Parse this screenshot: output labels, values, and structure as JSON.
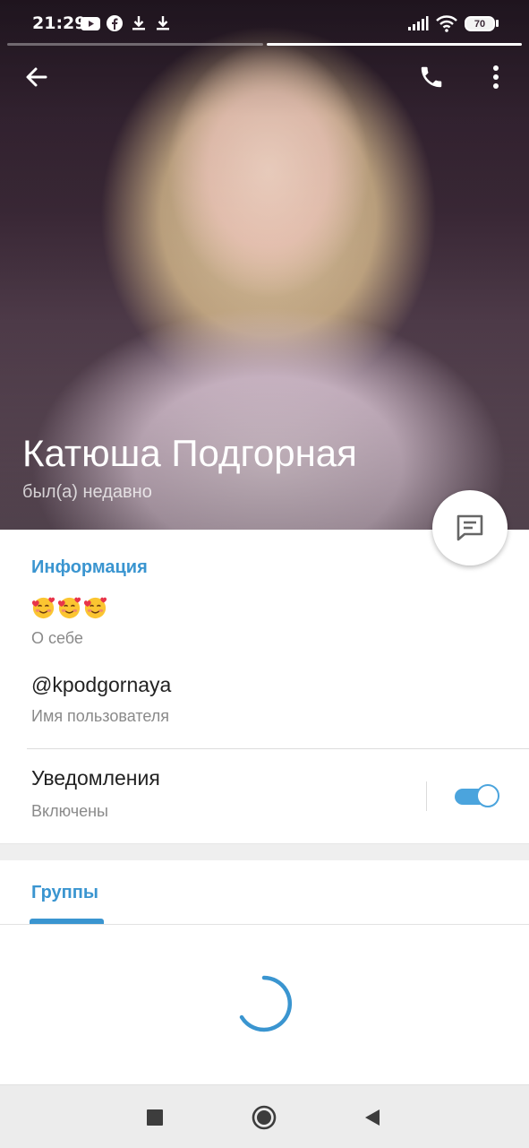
{
  "status_bar": {
    "time": "21:29",
    "battery": "70",
    "left_icons": [
      "youtube-icon",
      "facebook-icon",
      "download-icon",
      "download-icon"
    ],
    "right_icons": [
      "signal-icon",
      "wifi-icon",
      "battery-icon"
    ]
  },
  "toolbar": {
    "back_icon": "arrow-left-icon",
    "call_icon": "phone-icon",
    "menu_icon": "more-vertical-icon"
  },
  "profile": {
    "name": "Катюша Подгорная",
    "status": "был(а) недавно",
    "message_button_icon": "message-icon",
    "photo_pages": 2,
    "current_photo_page": 2
  },
  "info": {
    "title": "Информация",
    "bio_value": "🥰🥰🥰",
    "bio_label": "О себе",
    "username_value": "@kpodgornaya",
    "username_label": "Имя пользователя",
    "notifications_label": "Уведомления",
    "notifications_state": "Включены",
    "notifications_enabled": true
  },
  "tabs": {
    "groups": "Группы"
  },
  "colors": {
    "accent": "#3a95d0",
    "toggle": "#4ba4dd"
  },
  "navigation": [
    "recents-button",
    "home-button",
    "back-button"
  ]
}
